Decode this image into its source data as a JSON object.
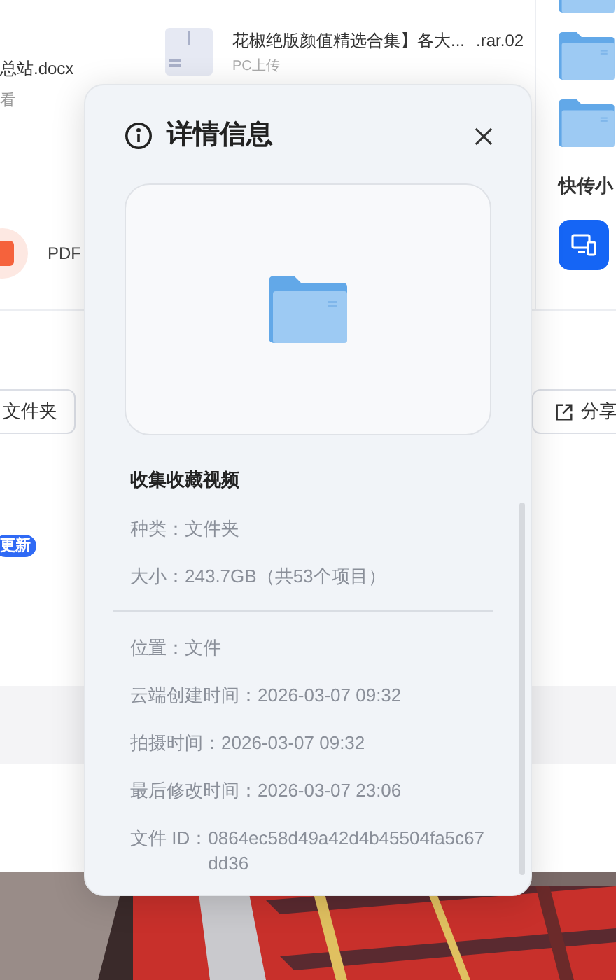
{
  "background": {
    "file": {
      "name": "花椒绝版颜值精选合集】各大...",
      "ext": ".rar.02",
      "source": "PC上传"
    },
    "left_item": {
      "name": "总站.docx",
      "meta": "看"
    },
    "tool": {
      "label": "PDF"
    },
    "right_panel": {
      "title": "快传小"
    },
    "buttons": [
      {
        "label": "文件夹",
        "kind": "plain"
      },
      {
        "label": "分享",
        "kind": "share"
      }
    ],
    "badge": "更新"
  },
  "dialog": {
    "title": "详情信息",
    "name": "收集收藏视频",
    "fields": [
      {
        "label": "种类：",
        "value": "文件夹"
      },
      {
        "label": "大小：",
        "value": "243.7GB（共53个项目）"
      }
    ],
    "details": [
      {
        "label": "位置：",
        "value": "文件"
      },
      {
        "label": "云端创建时间：",
        "value": "2026-03-07 09:32"
      },
      {
        "label": "拍摄时间：",
        "value": "2026-03-07 09:32"
      },
      {
        "label": "最后修改时间：",
        "value": "2026-03-07 23:06"
      },
      {
        "label": "文件 ID：",
        "value": "0864ec58d49a42d4b45504fa5c67dd36"
      }
    ]
  }
}
